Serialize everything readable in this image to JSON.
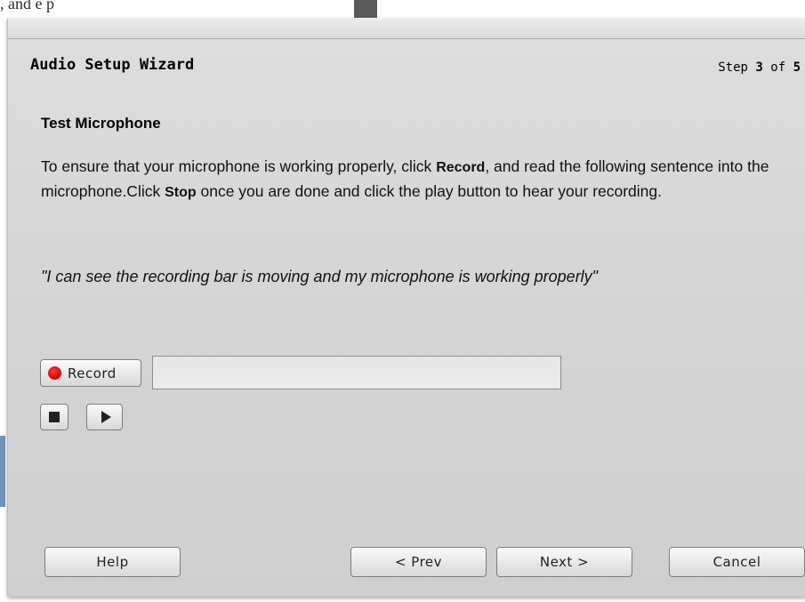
{
  "background": {
    "clipped_text": "   , and     e p"
  },
  "wizard": {
    "title": "Audio Setup Wizard",
    "step_prefix": "Step",
    "step_current": "3",
    "step_of": "of",
    "step_total": "5"
  },
  "content": {
    "heading": "Test Microphone",
    "instr_1": "To ensure that your microphone is working properly, click ",
    "instr_record": "Record",
    "instr_2": ", and read the following sentence into the microphone.Click ",
    "instr_stop": "Stop",
    "instr_3": " once you are done and click the play button to hear your recording.",
    "quote": "\"I can see the recording bar is moving and my microphone is working properly\""
  },
  "recorder": {
    "record_label": "Record",
    "level_fraction": 0,
    "stop_icon": "stop-icon",
    "play_icon": "play-icon"
  },
  "footer": {
    "help_label": "Help",
    "prev_label": "< Prev",
    "next_label": "Next >",
    "cancel_label": "Cancel"
  },
  "colors": {
    "record_dot": "#d40000",
    "dialog_bg": "#d6d6d6"
  }
}
